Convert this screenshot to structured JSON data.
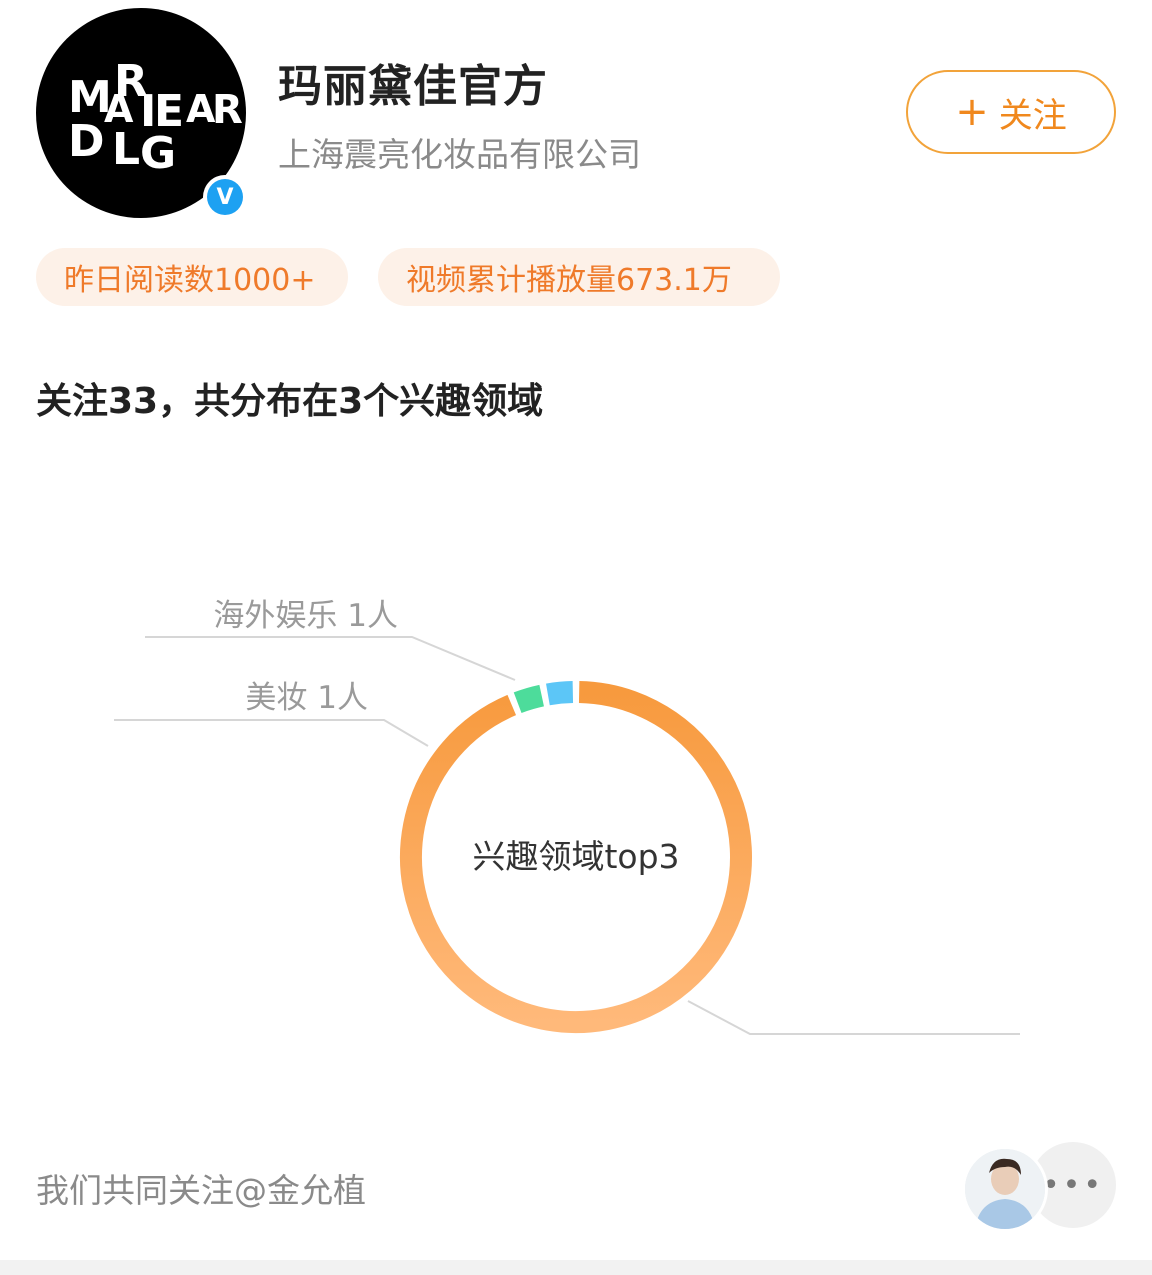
{
  "profile": {
    "name": "玛丽黛佳官方",
    "company": "上海震亮化妆品有限公司",
    "logo_letters": "MARIEDALGAR",
    "verified_mark": "V"
  },
  "follow_button": {
    "icon": "plus-icon",
    "label": "关注"
  },
  "stats": {
    "reads": "昨日阅读数1000+",
    "video_plays": "视频累计播放量673.1万"
  },
  "follow_summary": "关注33，共分布在3个兴趣领域",
  "chart_data": {
    "type": "pie",
    "center_label": "兴趣领域top3",
    "slices": [
      {
        "label": "",
        "value": 31,
        "color": "#f79d45"
      },
      {
        "label": "海外娱乐 1人",
        "value": 1,
        "color": "#5cc6f7"
      },
      {
        "label": "美妆 1人",
        "value": 1,
        "color": "#4ddc9b"
      }
    ]
  },
  "mutual_follow": "我们共同关注@金允植",
  "more_icon": "more-dots-icon",
  "colors": {
    "accent": "#f0881d",
    "pill_bg": "#fdf1e8",
    "donut_main": "#f79d45",
    "donut_blue": "#5cc6f7",
    "donut_green": "#4ddc9b"
  }
}
